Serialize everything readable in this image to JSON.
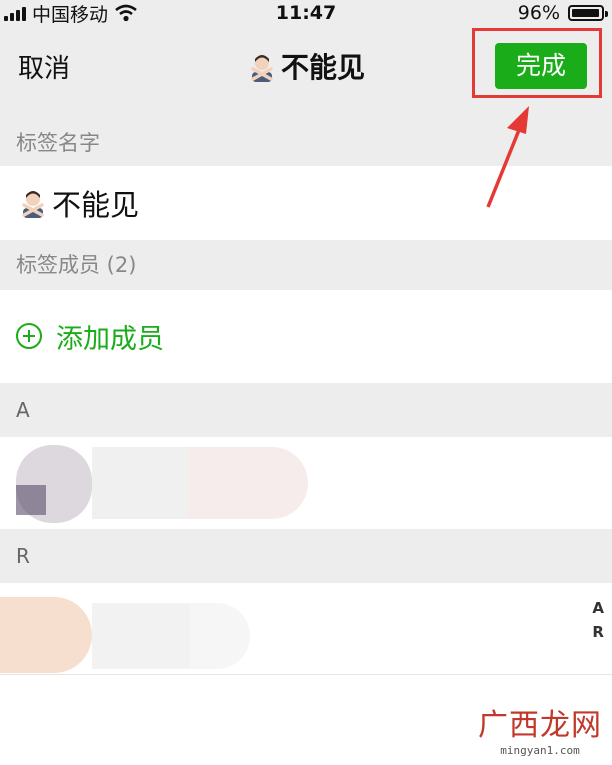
{
  "status_bar": {
    "carrier": "中国移动",
    "time": "11:47",
    "battery_percent": "96%",
    "battery_level": 0.96
  },
  "nav": {
    "cancel_label": "取消",
    "title": "不能见",
    "done_label": "完成"
  },
  "tag_name_section": {
    "label": "标签名字",
    "value": "不能见"
  },
  "members_section": {
    "label": "标签成员 (2)",
    "add_label": "添加成员"
  },
  "groups": [
    {
      "letter": "A"
    },
    {
      "letter": "R"
    }
  ],
  "index_bar": [
    "A",
    "R"
  ],
  "watermark": {
    "title": "广西龙网",
    "url": "mingyan1.com"
  },
  "colors": {
    "accent": "#1aad19",
    "highlight": "#e53935",
    "background": "#ededed"
  },
  "icons": {
    "tag_emoji": "person-gesturing-no-icon",
    "add": "plus-circle-icon",
    "annotation": "red-arrow-icon"
  }
}
